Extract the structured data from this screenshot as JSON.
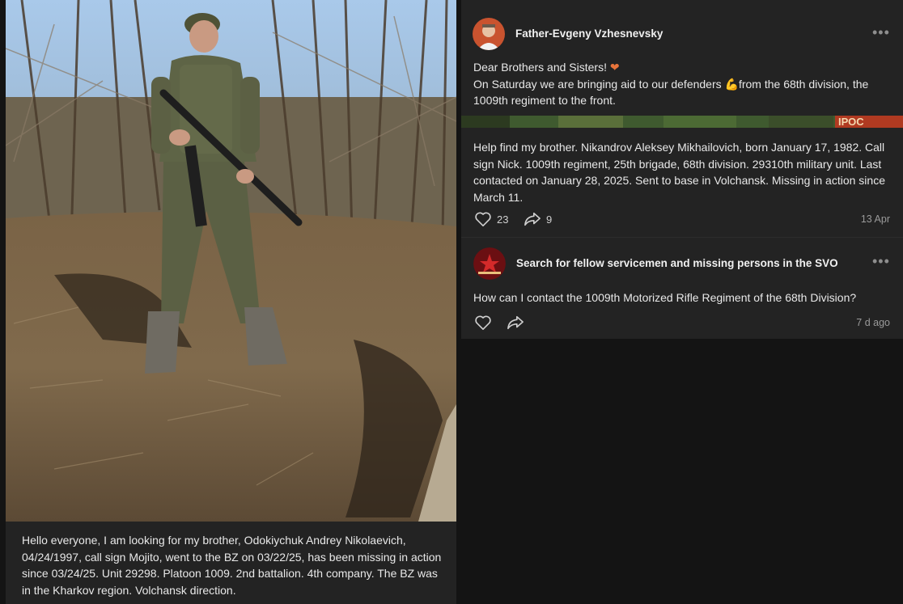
{
  "left_post": {
    "text": "Hello everyone, I am looking for my brother, Odokiychuk Andrey Nikolaevich, 04/24/1997, call sign Mojito, went to the BZ on 03/22/25, has been missing in action since 03/24/25. Unit 29298. Platoon 1009. 2nd battalion. 4th company. The BZ was in the Kharkov region. Volchansk direction."
  },
  "post1": {
    "author": "Father-Evgeny Vzhesnevsky",
    "line1": "Dear Brothers and Sisters! ",
    "heart": "❤",
    "line2a": "On Saturday we are bringing aid to our defenders ",
    "muscle": "💪",
    "line2b": "from the 68th division, the 1009th regiment to the front.",
    "strip_text": "ІРОС"
  },
  "post2": {
    "text": "Help find my brother. Nikandrov Aleksey Mikhailovich, born January 17, 1982. Call sign Nick. 1009th regiment, 25th brigade, 68th division. 29310th military unit. Last contacted on January 28, 2025. Sent to base in Volchansk. Missing in action since March 11.",
    "likes": "23",
    "shares": "9",
    "date": "13 Apr"
  },
  "post3": {
    "author": "Search for fellow servicemen and missing persons in the SVO",
    "text": "How can I contact the 1009th Motorized Rifle Regiment of the 68th Division?",
    "date": "7 d ago"
  },
  "icons": {
    "more": "more-dots-icon",
    "like": "heart-icon",
    "share": "share-arrow-icon"
  },
  "colors": {
    "card_bg": "#232323",
    "page_bg": "#141414",
    "accent_heart": "#e8743b",
    "muscle": "#f2b12e"
  }
}
